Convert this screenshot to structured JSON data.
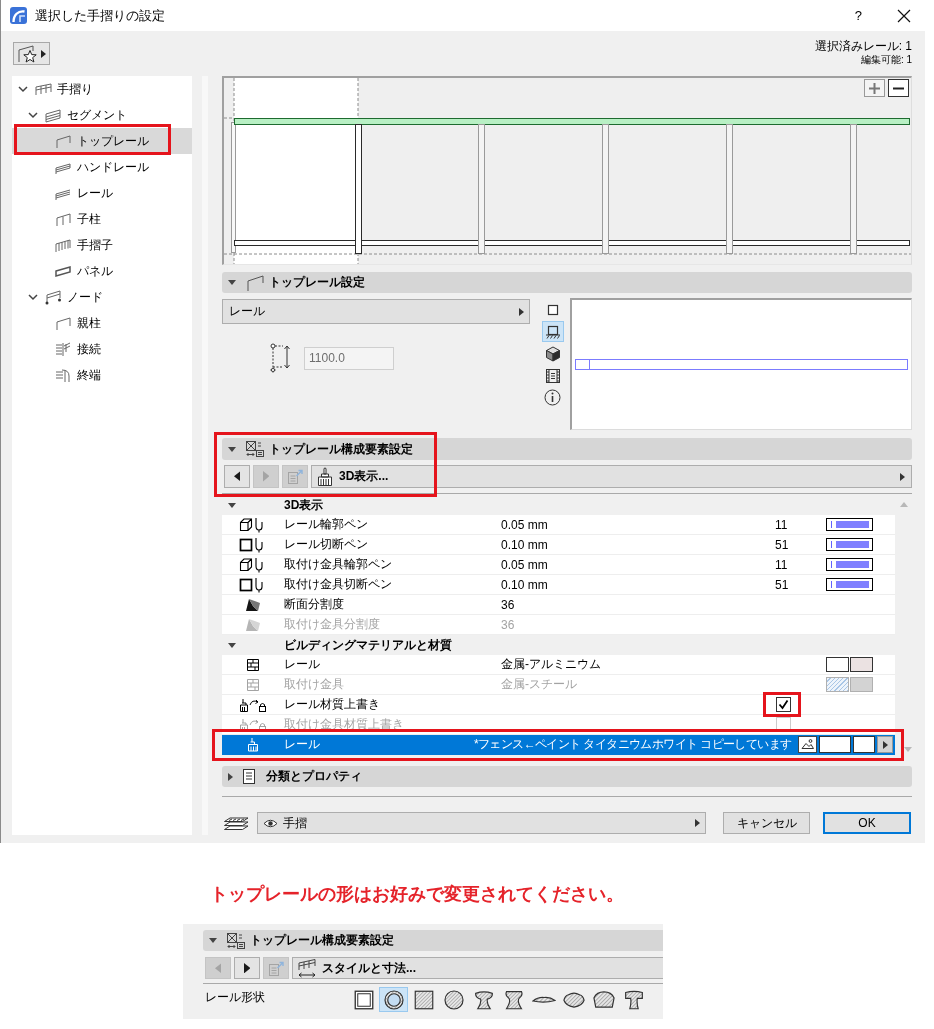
{
  "window": {
    "title": "選択した手摺りの設定",
    "help": "?"
  },
  "selection_info": [
    "選択済みレール: 1",
    "編集可能: 1"
  ],
  "tree": [
    {
      "label": "手摺り",
      "kind": "railing",
      "expanded": true,
      "selected": false,
      "highlighted": false,
      "children": [
        {
          "label": "セグメント",
          "kind": "segment",
          "expanded": true,
          "selected": false,
          "highlighted": false,
          "children": [
            {
              "label": "トップレール",
              "kind": "toprail",
              "selected": true,
              "highlighted": true
            },
            {
              "label": "ハンドレール",
              "kind": "handrail",
              "selected": false,
              "highlighted": false
            },
            {
              "label": "レール",
              "kind": "rail",
              "selected": false,
              "highlighted": false
            },
            {
              "label": "子柱",
              "kind": "post",
              "selected": false,
              "highlighted": false
            },
            {
              "label": "手摺子",
              "kind": "baluster",
              "selected": false,
              "highlighted": false
            },
            {
              "label": "パネル",
              "kind": "panel",
              "selected": false,
              "highlighted": false
            }
          ]
        },
        {
          "label": "ノード",
          "kind": "node",
          "expanded": true,
          "selected": false,
          "highlighted": false,
          "children": [
            {
              "label": "親柱",
              "kind": "mainpost",
              "selected": false,
              "highlighted": false
            },
            {
              "label": "接続",
              "kind": "connection",
              "selected": false,
              "highlighted": false
            },
            {
              "label": "終端",
              "kind": "end",
              "selected": false,
              "highlighted": false
            }
          ]
        }
      ]
    }
  ],
  "rail_settings": {
    "title": "トップレール設定",
    "expanded": true,
    "profile": "レール",
    "height": {
      "value": "1100.0",
      "disabled": true
    },
    "view_modes": [
      {
        "kind": "square",
        "selected": false
      },
      {
        "kind": "base",
        "selected": true
      },
      {
        "kind": "cube",
        "selected": false
      },
      {
        "kind": "strip",
        "selected": false
      },
      {
        "kind": "info",
        "selected": false
      }
    ]
  },
  "component_settings": {
    "title": "トップレール構成要素設定",
    "expanded": true,
    "highlighted": true,
    "nav": [
      {
        "kind": "prev",
        "disabled": false
      },
      {
        "kind": "next",
        "disabled": true
      },
      {
        "kind": "export",
        "disabled": true
      }
    ],
    "page": {
      "label": "3D表示...",
      "kind": "brush"
    },
    "groups": [
      {
        "title": "3D表示",
        "expanded": true,
        "rows": [
          {
            "kind": "contour",
            "label": "レール輪郭ペン",
            "value": "0.05 mm",
            "pen": "11",
            "selected": false,
            "disabled": false,
            "highlighted": false
          },
          {
            "kind": "cut",
            "label": "レール切断ペン",
            "value": "0.10 mm",
            "pen": "51",
            "selected": false,
            "disabled": false,
            "highlighted": false
          },
          {
            "kind": "contour",
            "label": "取付け金具輪郭ペン",
            "value": "0.05 mm",
            "pen": "11",
            "selected": false,
            "disabled": false,
            "highlighted": false
          },
          {
            "kind": "cut",
            "label": "取付け金具切断ペン",
            "value": "0.10 mm",
            "pen": "51",
            "selected": false,
            "disabled": false,
            "highlighted": false
          },
          {
            "kind": "resolution",
            "label": "断面分割度",
            "value": "36",
            "selected": false,
            "disabled": false,
            "highlighted": false
          },
          {
            "kind": "resolution",
            "label": "取付け金具分割度",
            "value": "36",
            "selected": false,
            "disabled": true,
            "highlighted": false
          }
        ]
      },
      {
        "title": "ビルディングマテリアルと材質",
        "expanded": true,
        "rows": [
          {
            "kind": "material",
            "label": "レール",
            "value": "金属-アルミニウム",
            "color": "#ebe2e2",
            "selected": false,
            "disabled": false,
            "highlighted": false
          },
          {
            "kind": "material",
            "label": "取付け金具",
            "value": "金属-スチール",
            "color": "#d3d3d3",
            "selected": false,
            "disabled": true,
            "highlighted": false
          },
          {
            "kind": "override",
            "label": "レール材質上書き",
            "checked": true,
            "selected": false,
            "disabled": false,
            "highlighted": true
          },
          {
            "kind": "override",
            "label": "取付け金具材質上書き",
            "checked": false,
            "selected": false,
            "disabled": true,
            "highlighted": false
          },
          {
            "kind": "surface",
            "label": "レール",
            "value": "*フェンス←ペイント タイタニウムホワイト コピーしています",
            "color": "#ffffff",
            "selected": true,
            "disabled": false,
            "highlighted": true
          }
        ]
      }
    ]
  },
  "classification": {
    "title": "分類とプロパティ",
    "expanded": false
  },
  "footer": {
    "layer": "手摺",
    "buttons": [
      {
        "label": "キャンセル",
        "default": false
      },
      {
        "label": "OK",
        "default": true
      }
    ]
  },
  "note": "トップレールの形はお好みで変更されてください。",
  "example_panel": {
    "title": "トップレール構成要素設定",
    "expanded": true,
    "nav": [
      {
        "kind": "prev",
        "disabled": true
      },
      {
        "kind": "next",
        "disabled": false
      },
      {
        "kind": "export",
        "disabled": true
      }
    ],
    "page": {
      "label": "スタイルと寸法...",
      "kind": "dimensions"
    },
    "shape_label": "レール形状",
    "shapes": [
      {
        "kind": "frame",
        "selected": false
      },
      {
        "kind": "ring",
        "selected": true
      },
      {
        "kind": "square",
        "selected": false
      },
      {
        "kind": "round",
        "selected": false
      },
      {
        "kind": "mushroom",
        "selected": false
      },
      {
        "kind": "bell",
        "selected": false
      },
      {
        "kind": "flat",
        "selected": false
      },
      {
        "kind": "scallop",
        "selected": false
      },
      {
        "kind": "dome",
        "selected": false
      },
      {
        "kind": "tee",
        "selected": false
      }
    ]
  }
}
